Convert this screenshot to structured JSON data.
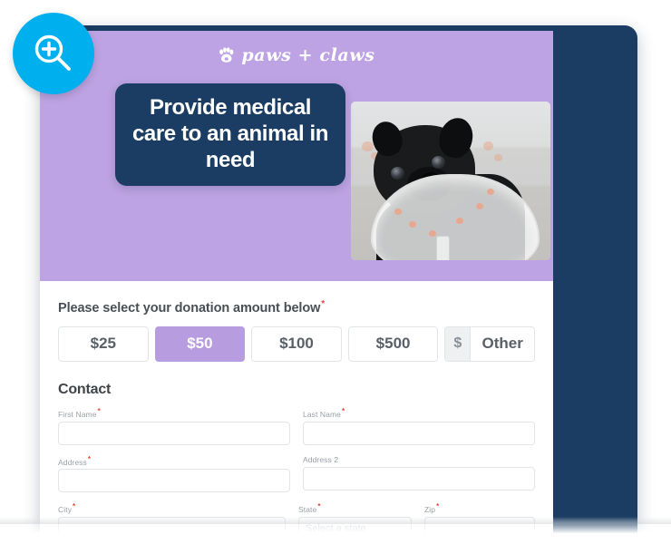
{
  "brand": {
    "logo_text": "paws + claws",
    "logo_icon": "paw-print-icon",
    "purple": "#bda3e3",
    "navy": "#1b3d63",
    "accent_purple": "#b79ce0",
    "badge_cyan": "#00b0ee",
    "required_red": "#e8453c"
  },
  "hero": {
    "headline": "Provide medical care to an animal in need",
    "photo_alt": "black-pug-wearing-cone-collar"
  },
  "donation": {
    "prompt": "Please select your donation amount below",
    "required_mark": "*",
    "amounts": [
      {
        "label": "$25",
        "selected": false
      },
      {
        "label": "$50",
        "selected": true
      },
      {
        "label": "$100",
        "selected": false
      },
      {
        "label": "$500",
        "selected": false
      }
    ],
    "other": {
      "currency_symbol": "$",
      "label": "Other",
      "value": ""
    }
  },
  "contact": {
    "title": "Contact",
    "fields": [
      {
        "label": "First Name",
        "required": true,
        "value": "",
        "placeholder": ""
      },
      {
        "label": "Last Name",
        "required": true,
        "value": "",
        "placeholder": ""
      },
      {
        "label": "Address",
        "required": true,
        "value": "",
        "placeholder": ""
      },
      {
        "label": "Address 2",
        "required": false,
        "value": "",
        "placeholder": ""
      },
      {
        "label": "City",
        "required": true,
        "value": "",
        "placeholder": ""
      },
      {
        "label": "State",
        "required": true,
        "value": "Select a state",
        "placeholder": "Select a state"
      },
      {
        "label": "Zip",
        "required": true,
        "value": "",
        "placeholder": ""
      }
    ]
  },
  "badge": {
    "icon": "zoom-in-magnifier-icon"
  }
}
